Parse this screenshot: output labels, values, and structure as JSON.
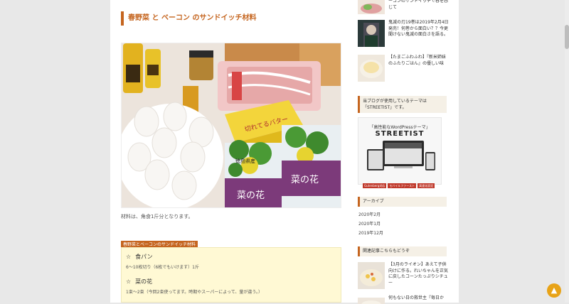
{
  "post": {
    "heading": "春野菜 と ベーコン のサンドイッチ材料",
    "caption": "材料は、角食1斤分となります。",
    "materials_tag": "春野菜とベーコンのサンドイッチ材料",
    "materials": [
      {
        "star": "☆",
        "name": "食パン",
        "desc": "6〜10枚切り（6枚でもいけます）1斤"
      },
      {
        "star": "☆",
        "name": "菜の花",
        "desc": "1束〜2束（今回2束使ってます。時期やスーパーによって、量が違う。）"
      }
    ],
    "photo_labels": {
      "package1": "徳島県産",
      "package2": "菜の花",
      "butter": "切れてるバター"
    }
  },
  "sidebar": {
    "entries_top": [
      {
        "text": "ーコンのサンドイッチで春を感じて"
      },
      {
        "text": "鬼滅の刃19巻は2019年2月4日発売！何巻から面白い？？今更聞けない鬼滅の面白さを語る。"
      },
      {
        "text": "【たまごふわふわ】『新米姉妹のふたりごはん』の優しい味"
      }
    ],
    "theme_heading": "当ブログが使用しているテーマは「STREETIST」です。",
    "streetist": {
      "subtitle": "「高性能なWordPressテーマ」",
      "title": "STREETIST",
      "tags": [
        "Gutenberg対応",
        "モバイルファースト",
        "高速化設定"
      ]
    },
    "archive_heading": "アーカイブ",
    "archives": [
      "2020年2月",
      "2020年1月",
      "2019年12月"
    ],
    "related_heading": "関連記事こちらもどうぞ",
    "entries_bottom": [
      {
        "text": "【3月のライオン】あえて子供向けに作る。れいちゃんを正気に戻したコーンたっぷりシチュー"
      },
      {
        "text": "何もない日の救世主『毎日か"
      }
    ]
  },
  "ui": {
    "to_top": "▲"
  }
}
